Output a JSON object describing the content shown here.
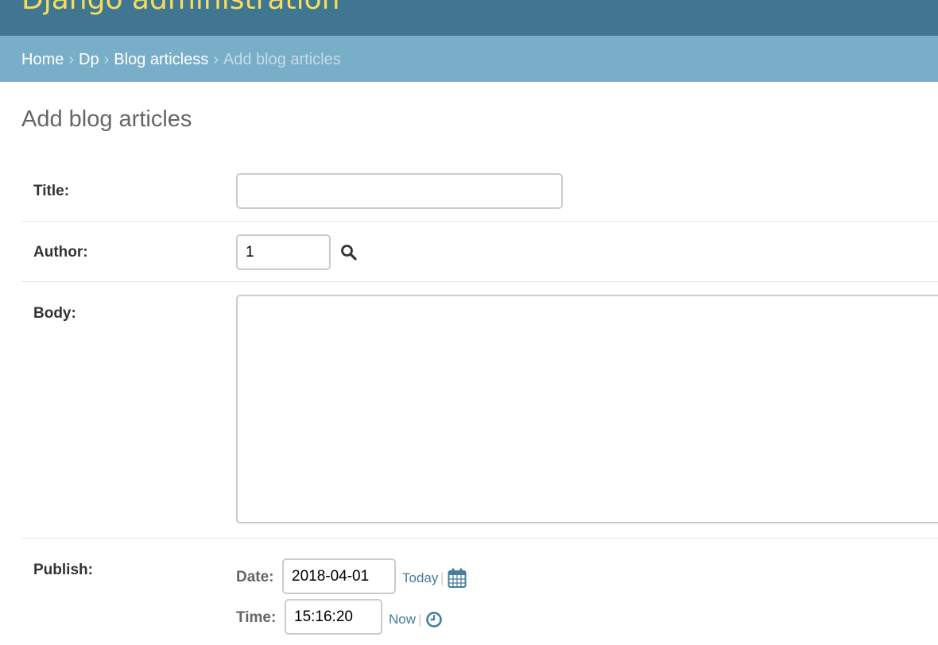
{
  "header": {
    "site_title": "Django administration"
  },
  "breadcrumbs": {
    "items": [
      "Home",
      "Dp",
      "Blog articless"
    ],
    "separator": "›",
    "current": "Add blog articles"
  },
  "page": {
    "title": "Add blog articles"
  },
  "form": {
    "title": {
      "label": "Title:",
      "value": ""
    },
    "author": {
      "label": "Author:",
      "value": "1",
      "lookup_icon": "search-icon"
    },
    "body": {
      "label": "Body:",
      "value": ""
    },
    "publish": {
      "label": "Publish:",
      "date_label": "Date:",
      "date_value": "2018-04-01",
      "today_link": "Today",
      "calendar_icon": "calendar-icon",
      "time_label": "Time:",
      "time_value": "15:16:20",
      "now_link": "Now",
      "clock_icon": "clock-icon",
      "pipe": "|"
    }
  },
  "colors": {
    "header_bg": "#417690",
    "site_title": "#f5dd5d",
    "breadcrumb_bg": "#79aec8",
    "link": "#447e9b"
  }
}
